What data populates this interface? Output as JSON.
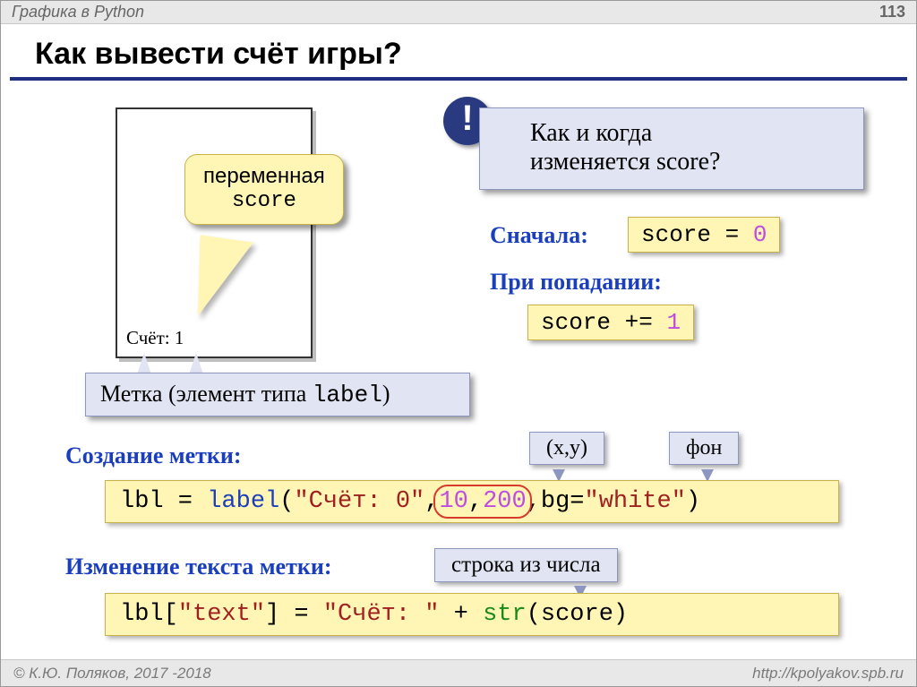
{
  "header": {
    "crumb": "Графика в Python",
    "page": "113"
  },
  "title": "Как вывести счёт игры?",
  "window": {
    "score_label": "Счёт: 1"
  },
  "callout_var": {
    "line1": "переменная",
    "line2_code": "score"
  },
  "label_box": {
    "prefix": "Метка (элемент типа ",
    "code": "label",
    "suffix": ")"
  },
  "question": {
    "mark": "!",
    "line1": "Как и когда",
    "line2": "изменяется score?"
  },
  "initial": {
    "label": "Сначала:",
    "code_lhs": "score",
    "code_op": " = ",
    "code_rhs": "0"
  },
  "on_hit": {
    "label": "При попадании:",
    "code_lhs": "score",
    "code_op": " += ",
    "code_rhs": "1"
  },
  "create": {
    "label": "Создание метки:"
  },
  "create_code": {
    "var": "lbl",
    "eq": " = ",
    "fn": "label",
    "open": "(",
    "str": "\"Счёт: 0\"",
    "c1": ",",
    "n1": "10",
    "c2": ",",
    "n2": "200",
    "c3": ",",
    "bg_key": "bg=",
    "bg_val": "\"white\"",
    "close": ")"
  },
  "hints": {
    "xy": "(x,y)",
    "bg": "фон",
    "strconv": "строка из числа"
  },
  "change": {
    "label": "Изменение текста метки:"
  },
  "change_code": {
    "lhs": "lbl[",
    "key": "\"text\"",
    "mid": "] = ",
    "str": "\"Счёт: \"",
    "plus": " + ",
    "fn": "str",
    "arg": "(score)"
  },
  "footer": {
    "copyright": "© К.Ю. Поляков, 2017 -2018",
    "url": "http://kpolyakov.spb.ru"
  }
}
